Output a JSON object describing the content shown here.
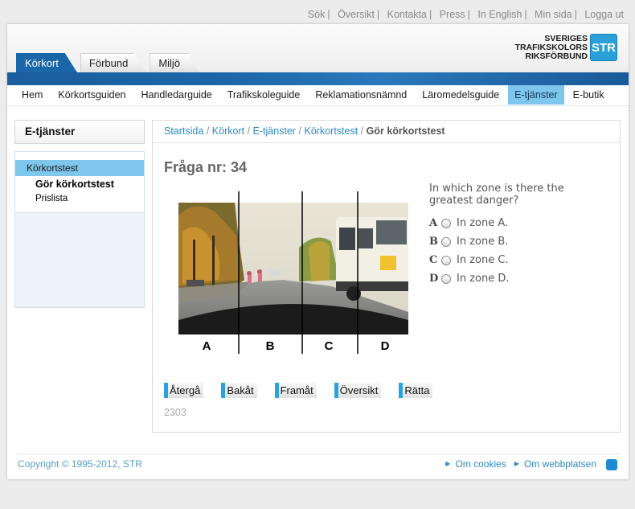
{
  "utility_links": [
    "Sök",
    "Översikt",
    "Kontakta",
    "Press",
    "In English",
    "Min sida",
    "Logga ut"
  ],
  "logo": {
    "line1": "SVERIGES",
    "line2": "TRAFIKSKOLORS",
    "line3": "RIKSFÖRBUND",
    "badge": "STR"
  },
  "tabs": [
    "Körkort",
    "Förbund",
    "Miljö"
  ],
  "main_nav": [
    "Hem",
    "Körkortsguiden",
    "Handledarguide",
    "Trafikskoleguide",
    "Reklamationsnämnd",
    "Läromedelsguide",
    "E-tjänster",
    "E-butik"
  ],
  "sidebar": {
    "title": "E-tjänster",
    "section": "Körkortstest",
    "items": [
      "Gör körkortstest",
      "Prislista"
    ]
  },
  "breadcrumb": {
    "links": [
      "Startsida",
      "Körkort",
      "E-tjänster",
      "Körkortstest"
    ],
    "separator": "/",
    "current": "Gör körkortstest"
  },
  "quiz": {
    "title": "Fråga nr: 34",
    "question": "In which zone is there the greatest danger?",
    "answers": [
      {
        "letter": "A",
        "text": "In zone A."
      },
      {
        "letter": "B",
        "text": "In zone B."
      },
      {
        "letter": "C",
        "text": "In zone C."
      },
      {
        "letter": "D",
        "text": "In zone D."
      }
    ],
    "zone_labels": [
      "A",
      "B",
      "C",
      "D"
    ],
    "question_id": "2303"
  },
  "buttons": [
    "Återgå",
    "Bakåt",
    "Framåt",
    "Översikt",
    "Rätta"
  ],
  "footer": {
    "copyright": "Copyright © 1995-2012, STR",
    "links": [
      "Om cookies",
      "Om webbplatsen"
    ]
  },
  "colors": {
    "brand_blue": "#1966a8",
    "accent_light_blue": "#7fc6ec",
    "link_blue": "#2a8ac4",
    "button_accent": "#29a3de"
  }
}
